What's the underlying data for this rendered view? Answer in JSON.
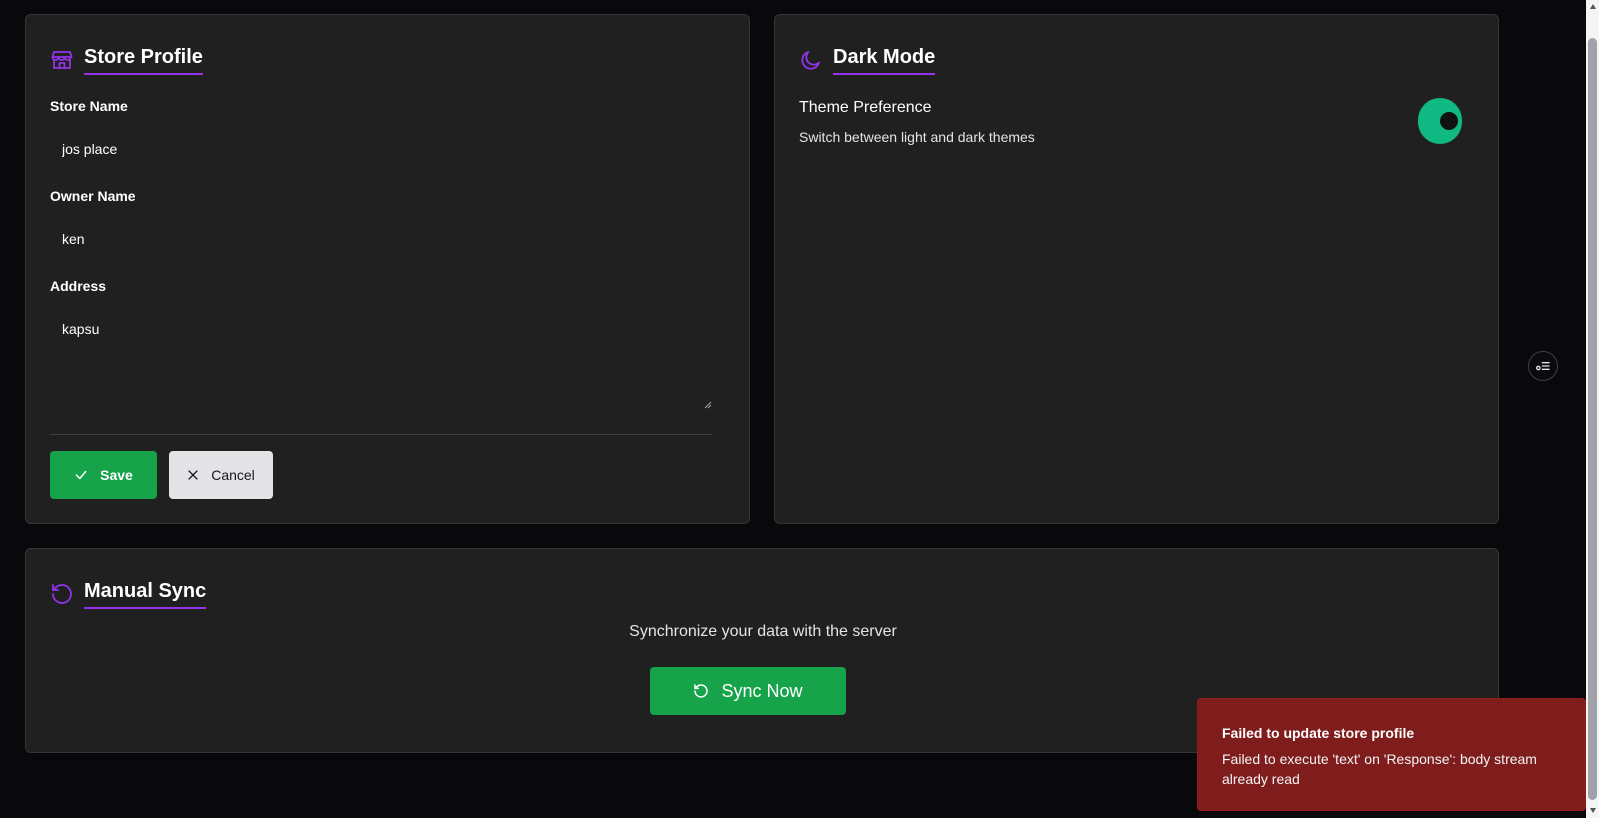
{
  "store_profile": {
    "title": "Store Profile",
    "icon": "store-icon",
    "fields": {
      "store_name": {
        "label": "Store Name",
        "value": "jos place"
      },
      "owner_name": {
        "label": "Owner Name",
        "value": "ken"
      },
      "address": {
        "label": "Address",
        "value": "kapsu"
      }
    },
    "save_label": "Save",
    "cancel_label": "Cancel"
  },
  "dark_mode": {
    "title": "Dark Mode",
    "icon": "moon-icon",
    "preference_title": "Theme Preference",
    "preference_desc": "Switch between light and dark themes",
    "enabled": true
  },
  "manual_sync": {
    "title": "Manual Sync",
    "icon": "refresh-icon",
    "description": "Synchronize your data with the server",
    "button_label": "Sync Now"
  },
  "toast": {
    "title": "Failed to update store profile",
    "message": "Failed to execute 'text' on 'Response': body stream already read"
  },
  "colors": {
    "accent": "#9333ea",
    "primary_button": "#16a34a",
    "toggle_on": "#10b981",
    "error": "#7f1d1d",
    "card_bg": "#202021",
    "page_bg": "#09090b"
  }
}
